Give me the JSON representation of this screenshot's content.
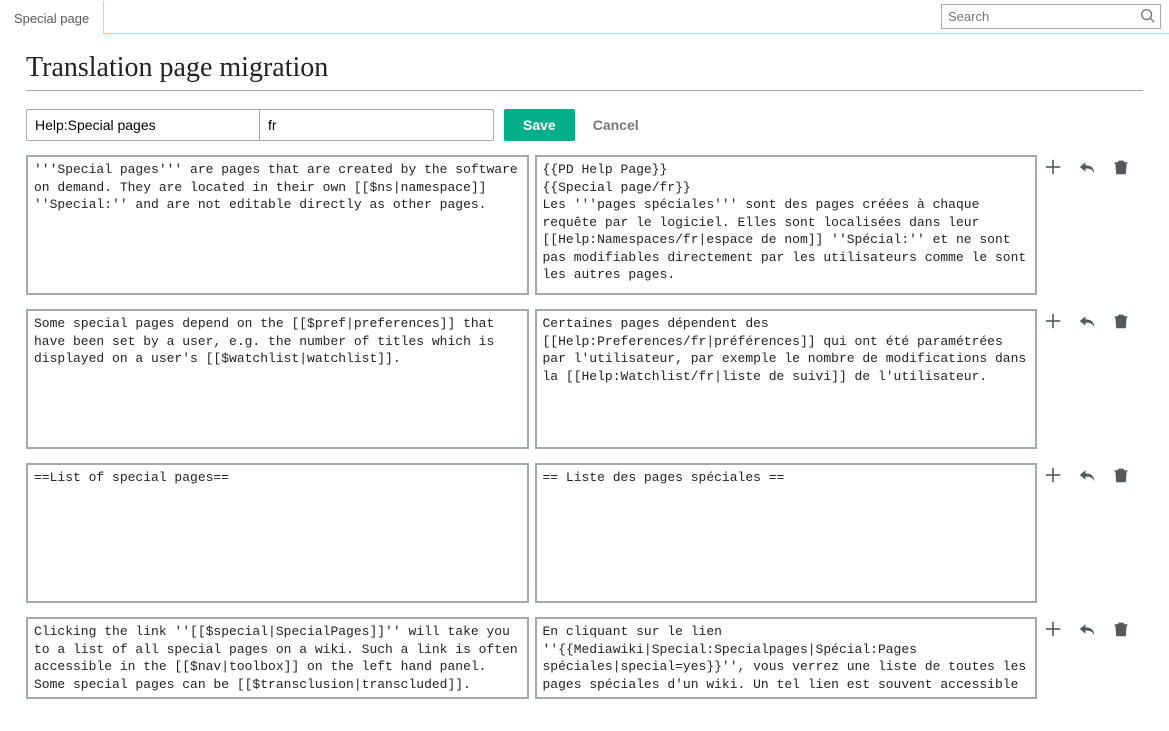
{
  "tab": "Special page",
  "search": {
    "placeholder": "Search"
  },
  "title": "Translation page migration",
  "controls": {
    "page_value": "Help:Special pages",
    "lang_value": "fr",
    "save_label": "Save",
    "cancel_label": "Cancel"
  },
  "units": [
    {
      "source": "'''Special pages''' are pages that are created by the software on demand. They are located in their own [[$ns|namespace]] ''Special:'' and are not editable directly as other pages.",
      "target": "{{PD Help Page}}\n{{Special page/fr}}\nLes '''pages spéciales''' sont des pages créées à chaque requête par le logiciel. Elles sont localisées dans leur [[Help:Namespaces/fr|espace de nom]] ''Spécial:'' et ne sont pas modifiables directement par les utilisateurs comme le sont les autres pages."
    },
    {
      "source": "Some special pages depend on the [[$pref|preferences]] that have been set by a user, e.g. the number of titles which is displayed on a user's [[$watchlist|watchlist]].",
      "target": "Certaines pages dépendent des [[Help:Preferences/fr|préférences]] qui ont été paramétrées par l'utilisateur, par exemple le nombre de modifications dans la [[Help:Watchlist/fr|liste de suivi]] de l'utilisateur."
    },
    {
      "source": "==List of special pages==",
      "target": "== Liste des pages spéciales =="
    },
    {
      "source": "Clicking the link ''[[$special|SpecialPages]]'' will take you to a list of all special pages on a wiki. Such a link is often accessible in the [[$nav|toolbox]] on the left hand panel. Some special pages can be [[$transclusion|transcluded]].",
      "target": "En cliquant sur le lien ''{{Mediawiki|Special:Specialpages|Spécial:Pages spéciales|special=yes}}'', vous verrez une liste de toutes les pages spéciales d'un wiki. Un tel lien est souvent accessible"
    }
  ]
}
